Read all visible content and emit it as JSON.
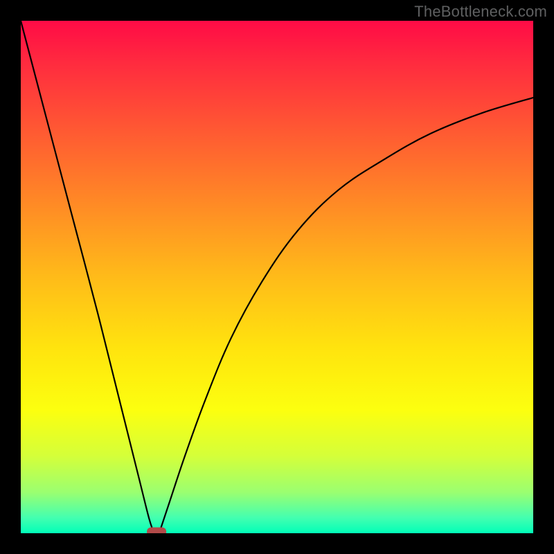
{
  "watermark": {
    "text": "TheBottleneck.com"
  },
  "chart_data": {
    "type": "line",
    "title": "",
    "xlabel": "",
    "ylabel": "",
    "xlim": [
      0,
      1
    ],
    "ylim": [
      0,
      1
    ],
    "grid": false,
    "legend": false,
    "background_gradient": {
      "top_color": "#ff0b46",
      "mid_color": "#ffe40e",
      "bottom_color": "#00ffb8"
    },
    "marker": {
      "description": "dark-red rounded marker at curve minimum",
      "color": "#b14a49",
      "x": 0.265,
      "y": 0.0
    },
    "series": [
      {
        "name": "left-branch",
        "x": [
          0.0,
          0.05,
          0.1,
          0.15,
          0.2,
          0.23,
          0.25,
          0.26
        ],
        "y": [
          1.0,
          0.81,
          0.62,
          0.43,
          0.23,
          0.11,
          0.03,
          0.0
        ]
      },
      {
        "name": "right-branch",
        "x": [
          0.27,
          0.29,
          0.32,
          0.36,
          0.41,
          0.47,
          0.54,
          0.62,
          0.71,
          0.8,
          0.9,
          1.0
        ],
        "y": [
          0.0,
          0.06,
          0.15,
          0.26,
          0.38,
          0.49,
          0.59,
          0.67,
          0.73,
          0.78,
          0.82,
          0.85
        ]
      }
    ]
  }
}
